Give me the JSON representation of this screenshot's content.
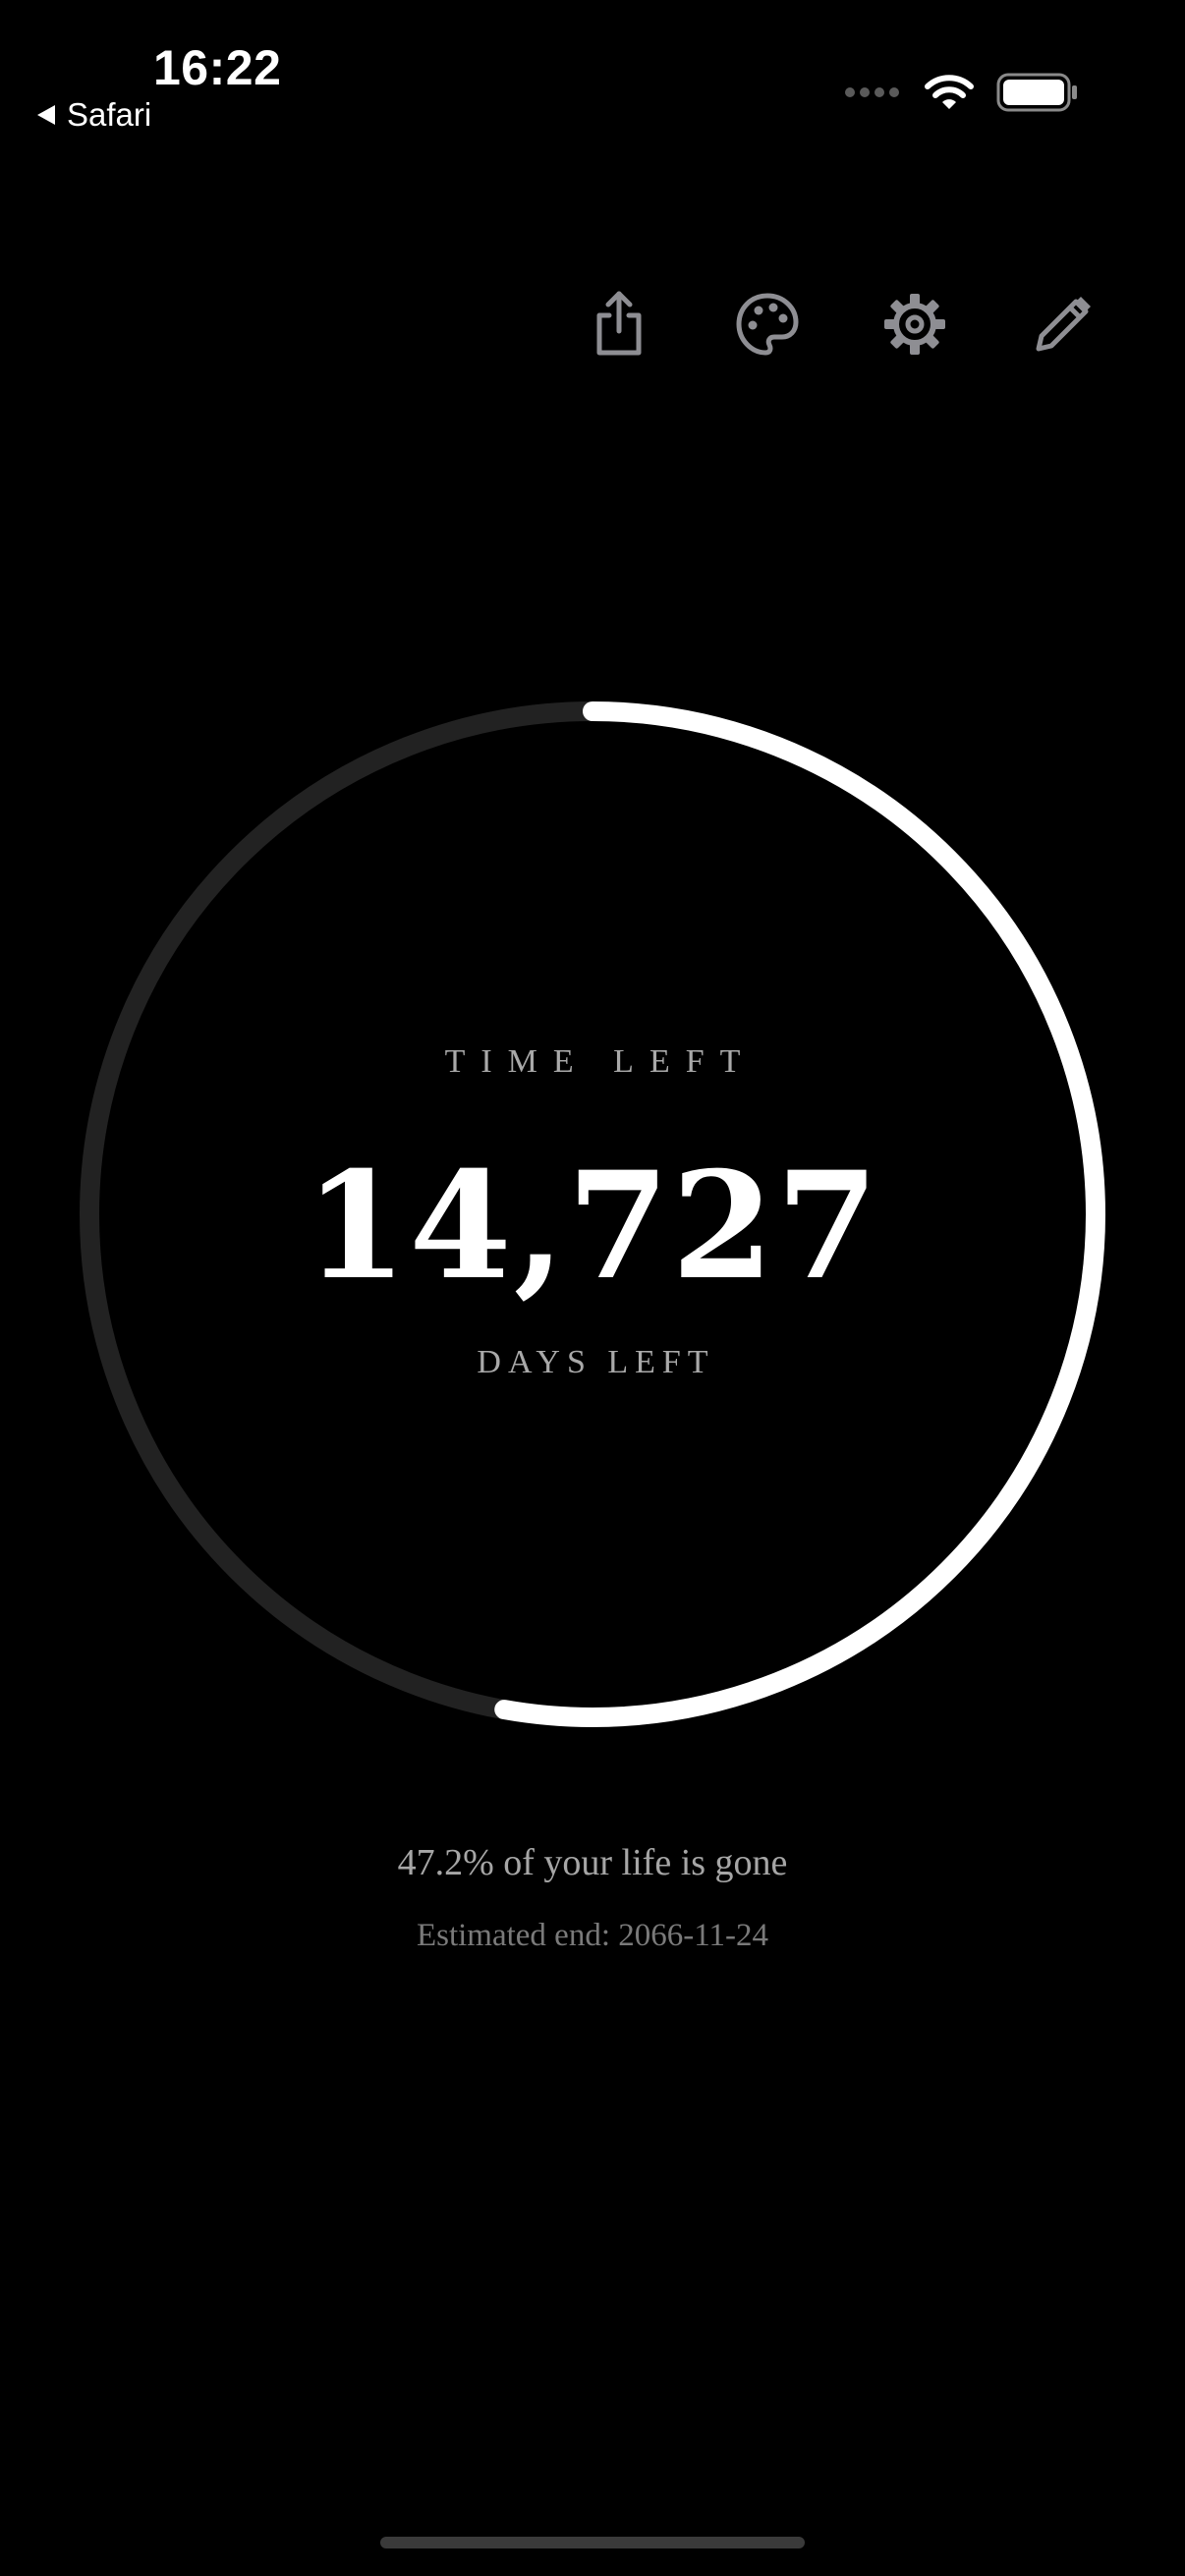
{
  "status_bar": {
    "time": "16:22",
    "back_label": "Safari",
    "icons": [
      "ellipsis-dots-icon",
      "wifi-icon",
      "battery-icon"
    ]
  },
  "toolbar": {
    "buttons": [
      {
        "name": "share",
        "icon": "share-icon"
      },
      {
        "name": "theme",
        "icon": "palette-icon"
      },
      {
        "name": "settings",
        "icon": "gear-icon"
      },
      {
        "name": "edit",
        "icon": "pencil-icon"
      }
    ]
  },
  "countdown": {
    "title": "TIME LEFT",
    "value": "14,727",
    "unit": "DAYS LEFT",
    "progress_remaining": 0.528,
    "colors": {
      "track": "#222222",
      "fill": "#ffffff"
    }
  },
  "stats": {
    "percent_gone_text": "47.2% of your life is gone",
    "estimated_end_text": "Estimated end: 2066-11-24"
  },
  "theme": {
    "background": "#000000",
    "text_primary": "#ffffff",
    "text_secondary": "#a9a9a9",
    "icon_color": "#8e8e93"
  }
}
